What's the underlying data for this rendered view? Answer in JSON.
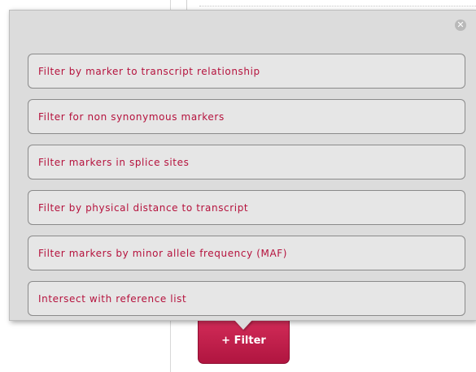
{
  "popup": {
    "close_icon": "close-icon",
    "options": [
      "Filter by marker to transcript relationship",
      "Filter for non synonymous markers",
      "Filter markers in splice sites",
      "Filter by physical distance to transcript",
      "Filter markers by minor allele frequency (MAF)",
      "Intersect with reference list"
    ]
  },
  "filter_button": {
    "label": "+ Filter"
  },
  "colors": {
    "accent": "#b5123d",
    "popup_bg": "#dcdcdc",
    "option_bg": "#e6e6e6",
    "button_bg": "#c41f4b"
  }
}
